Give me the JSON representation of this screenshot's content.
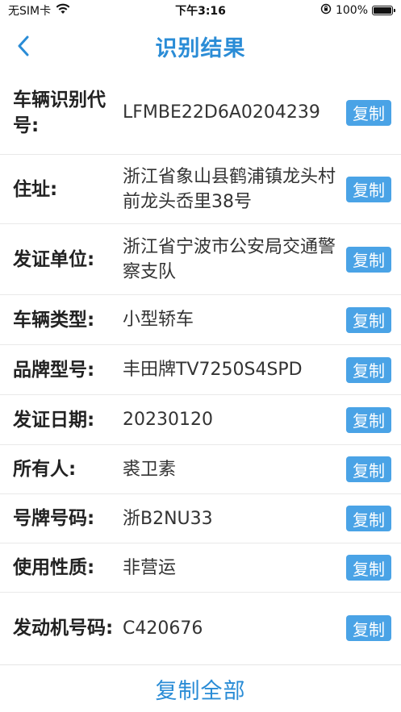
{
  "status_bar": {
    "carrier": "无SIM卡",
    "time": "下午3:16",
    "battery": "100%",
    "icons": [
      "wifi-icon",
      "orientation-lock-icon",
      "battery-icon"
    ]
  },
  "nav": {
    "title": "识别结果",
    "back_icon": "chevron-left-icon"
  },
  "colors": {
    "accent": "#2a8cd6",
    "button_bg": "#4aa3e6"
  },
  "fields": [
    {
      "label": "车辆识别代号:",
      "value": "LFMBE22D6A0204239",
      "copy": "复制"
    },
    {
      "label": "住址:",
      "value": "浙江省象山县鹤浦镇龙头村前龙头岙里38号",
      "copy": "复制"
    },
    {
      "label": "发证单位:",
      "value": "浙江省宁波市公安局交通警察支队",
      "copy": "复制"
    },
    {
      "label": "车辆类型:",
      "value": "小型轿车",
      "copy": "复制"
    },
    {
      "label": "品牌型号:",
      "value": "丰田牌TV7250S4SPD",
      "copy": "复制"
    },
    {
      "label": "发证日期:",
      "value": "20230120",
      "copy": "复制"
    },
    {
      "label": "所有人:",
      "value": "裘卫素",
      "copy": "复制"
    },
    {
      "label": "号牌号码:",
      "value": "浙B2NU33",
      "copy": "复制"
    },
    {
      "label": "使用性质:",
      "value": "非营运",
      "copy": "复制"
    },
    {
      "label": "发动机号码:",
      "value": "C420676",
      "copy": "复制"
    }
  ],
  "footer": {
    "copy_all": "复制全部"
  }
}
